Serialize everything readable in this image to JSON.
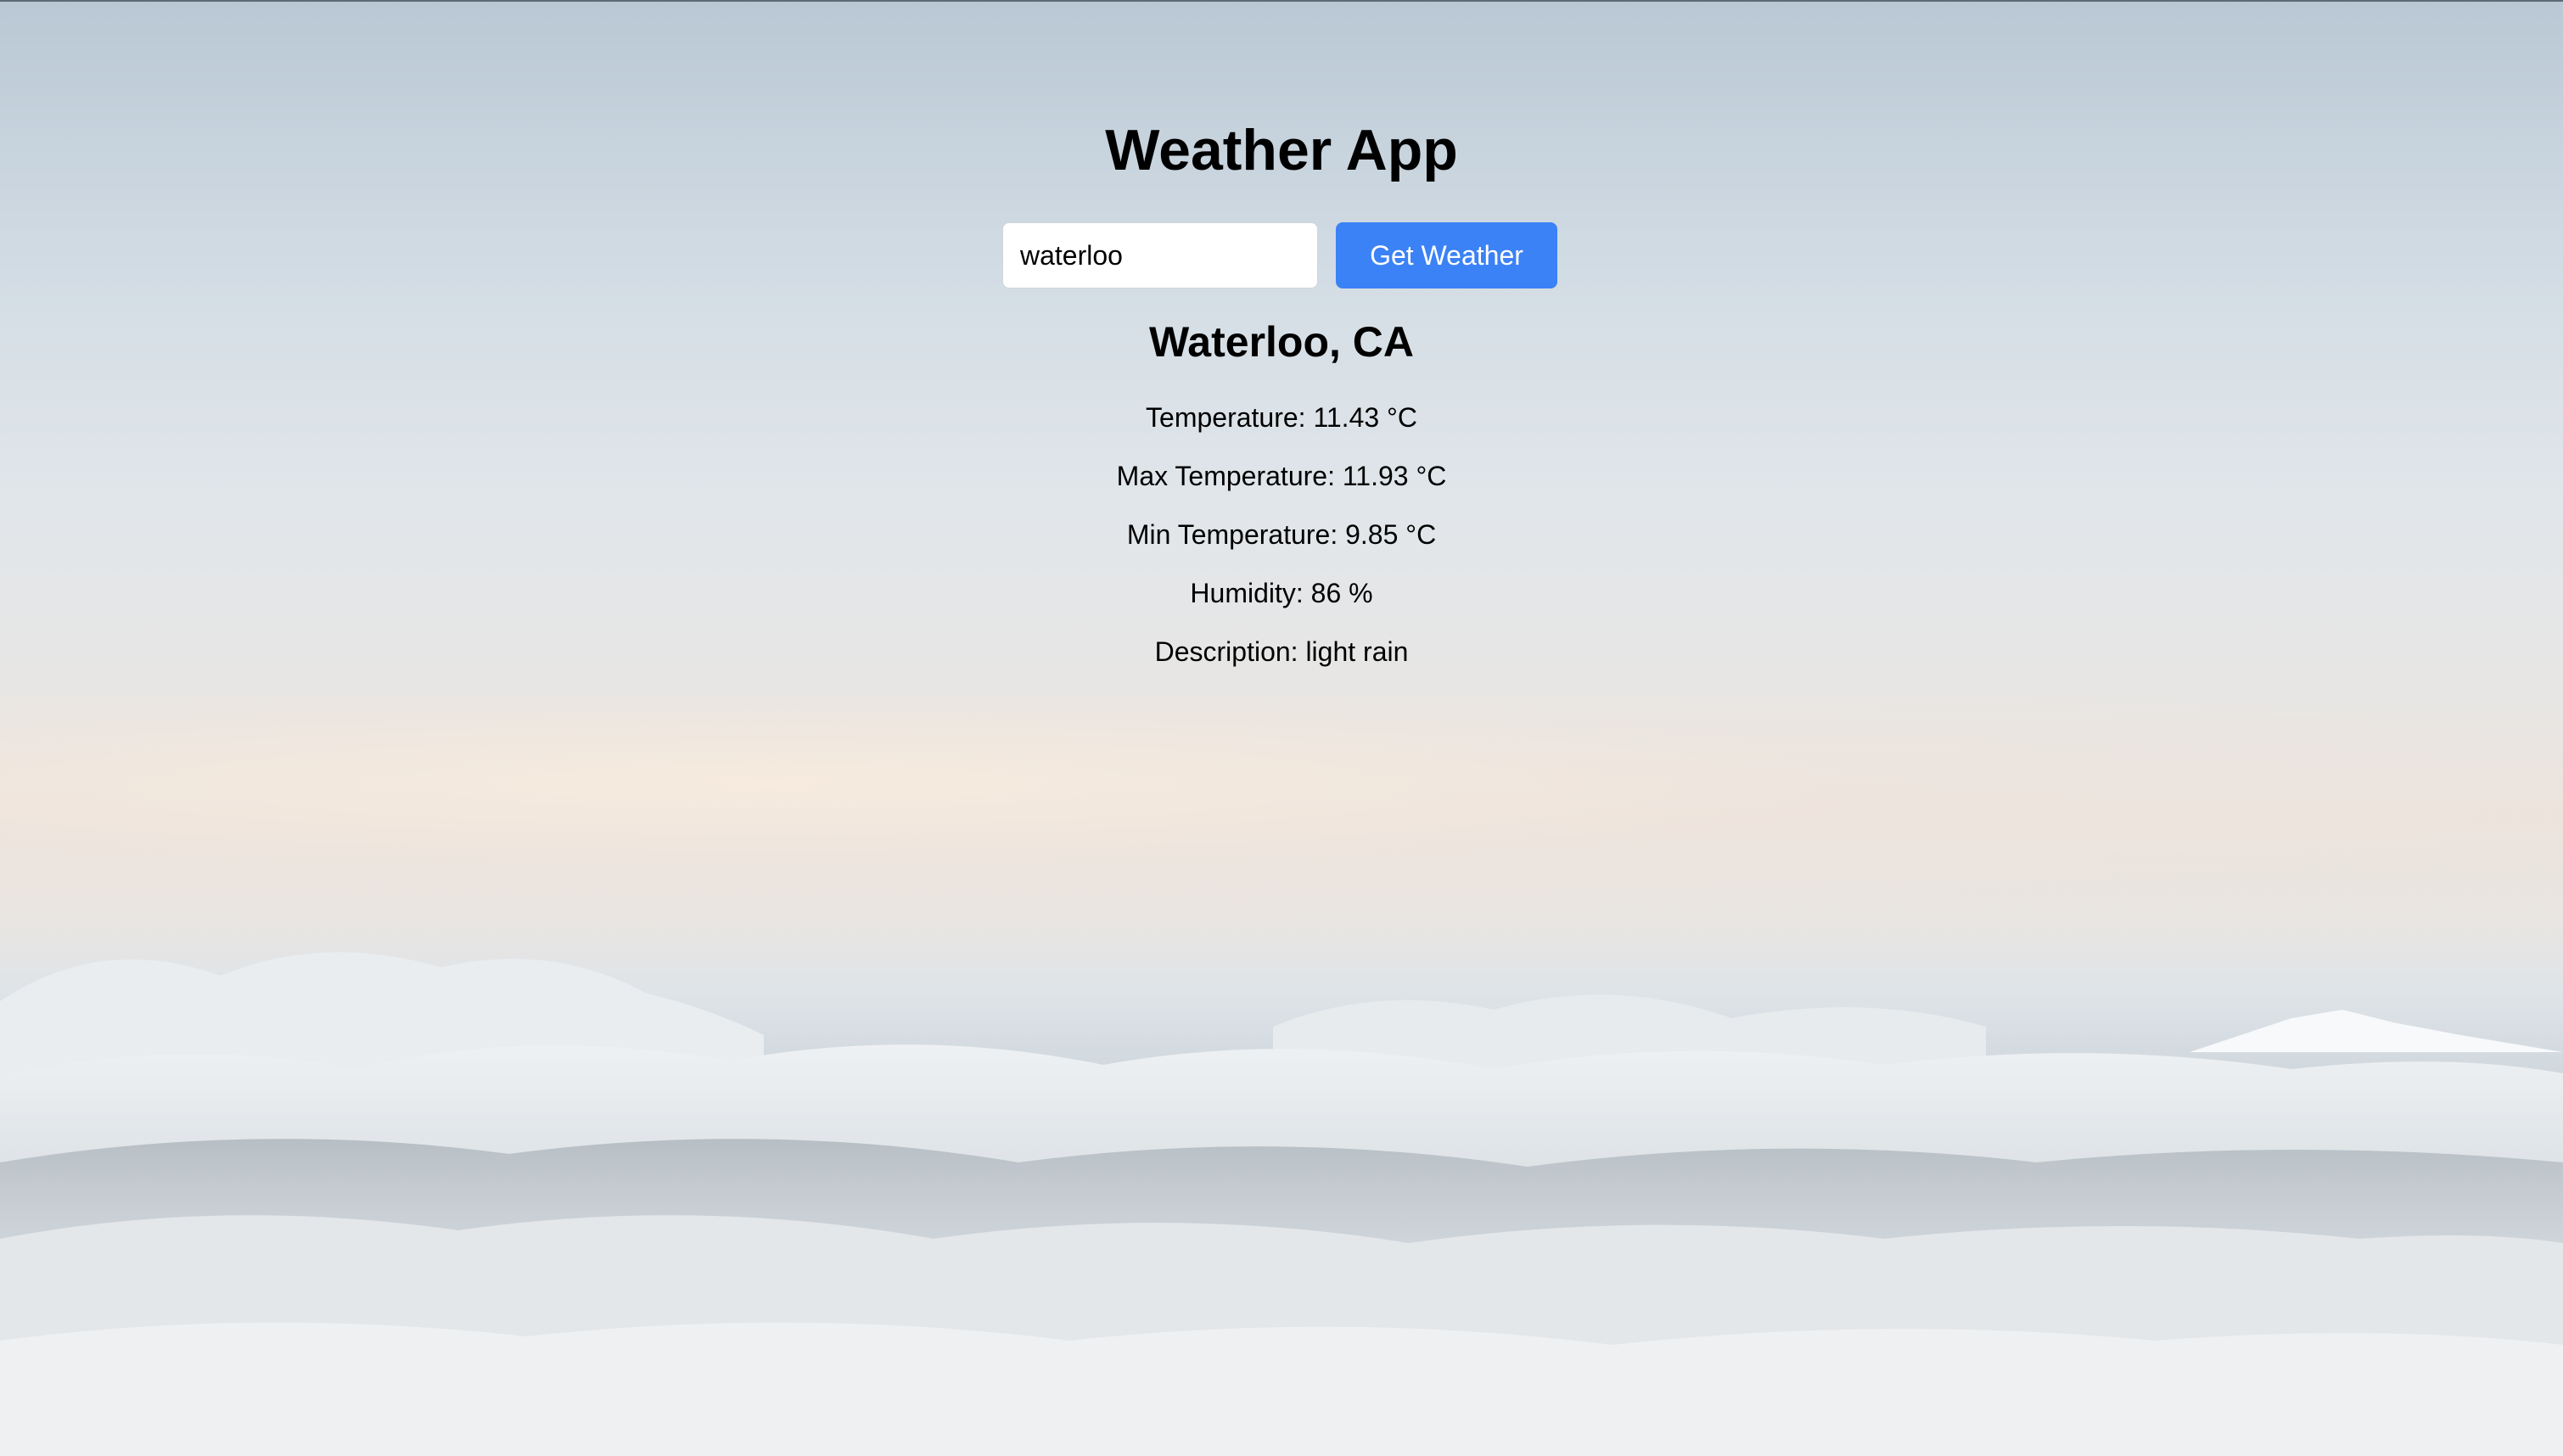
{
  "app": {
    "title": "Weather App"
  },
  "search": {
    "value": "waterloo",
    "button_label": "Get Weather"
  },
  "result": {
    "location": "Waterloo, CA",
    "temperature": "Temperature: 11.43 °C",
    "max_temperature": "Max Temperature: 11.93 °C",
    "min_temperature": "Min Temperature: 9.85 °C",
    "humidity": "Humidity: 86 %",
    "description": "Description: light rain"
  },
  "theme": {
    "button_color": "#3b82f6",
    "background": "cloudy-sky-mountains"
  }
}
